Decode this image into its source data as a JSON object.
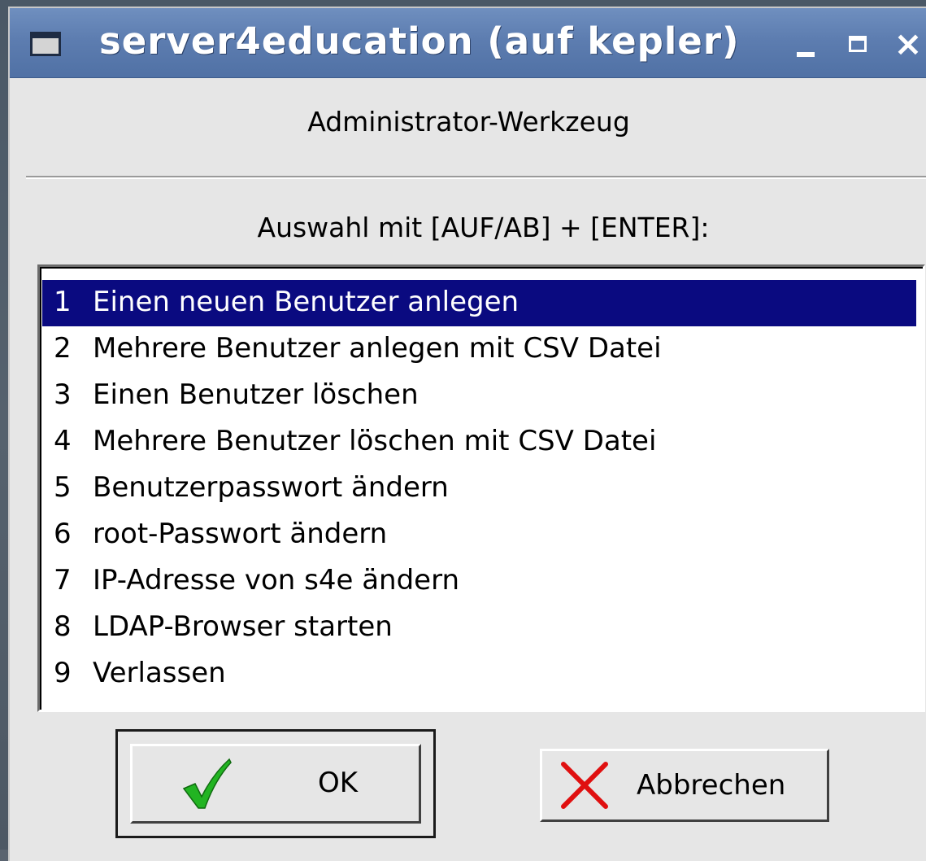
{
  "window": {
    "title": "server4education (auf kepler)",
    "minimize_glyph": "_",
    "close_glyph": "×"
  },
  "dialog": {
    "header": "Administrator-Werkzeug",
    "prompt": "Auswahl mit [AUF/AB] + [ENTER]:",
    "selected_index": 0,
    "items": [
      {
        "num": "1",
        "label": "Einen neuen Benutzer anlegen"
      },
      {
        "num": "2",
        "label": "Mehrere Benutzer anlegen mit CSV Datei"
      },
      {
        "num": "3",
        "label": "Einen Benutzer löschen"
      },
      {
        "num": "4",
        "label": "Mehrere Benutzer löschen mit CSV Datei"
      },
      {
        "num": "5",
        "label": "Benutzerpasswort ändern"
      },
      {
        "num": "6",
        "label": "root-Passwort ändern"
      },
      {
        "num": "7",
        "label": "IP-Adresse von s4e ändern"
      },
      {
        "num": "8",
        "label": "LDAP-Browser starten"
      },
      {
        "num": "9",
        "label": "Verlassen"
      }
    ]
  },
  "buttons": {
    "ok_label": "OK",
    "ok_icon": "checkmark-icon",
    "cancel_label": "Abbrechen",
    "cancel_icon": "cross-icon"
  },
  "colors": {
    "titlebar": "#5d7db0",
    "selection": "#0a0a80",
    "check": "#22b422",
    "cross": "#e01010"
  }
}
